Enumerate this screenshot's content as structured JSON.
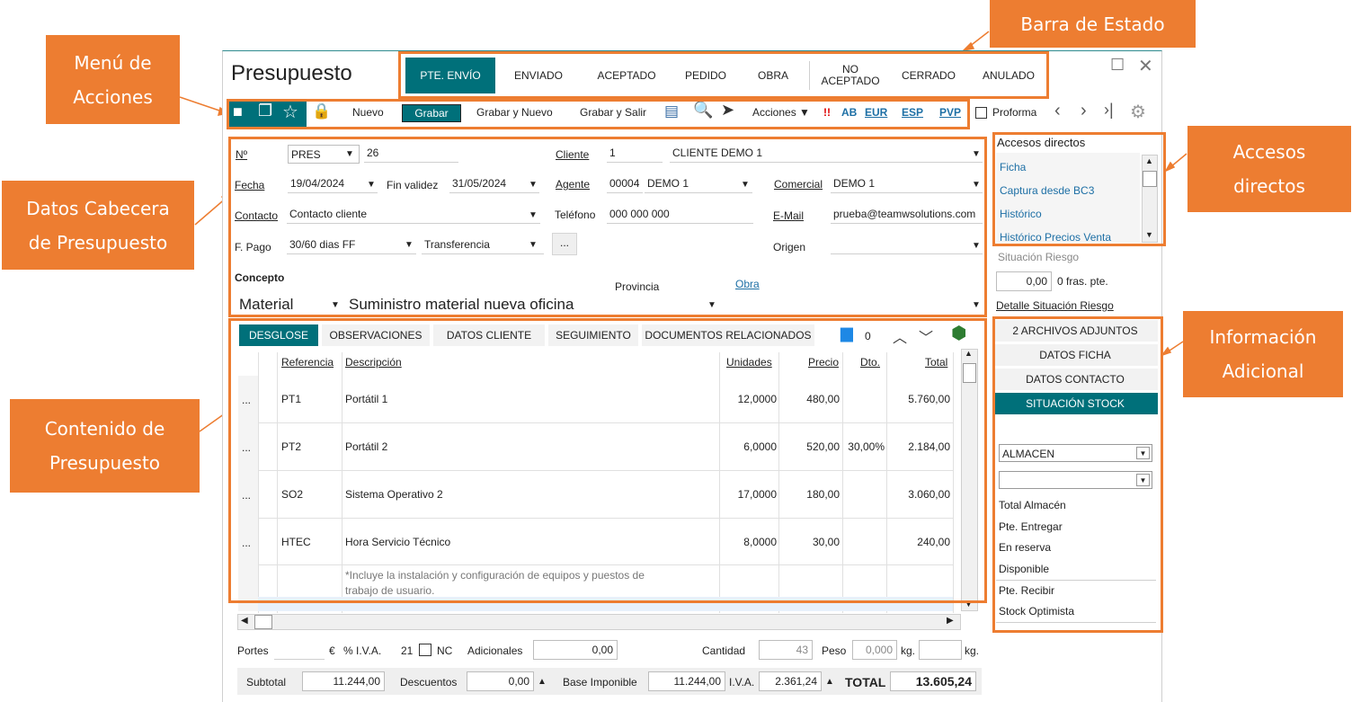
{
  "callouts": {
    "status_bar": "Barra de Estado",
    "actions_menu": "Menú de\nAcciones",
    "header_data": "Datos Cabecera\nde Presupuesto",
    "content": "Contenido de\nPresupuesto",
    "shortcuts": "Accesos\ndirectos",
    "additional": "Información\nAdicional"
  },
  "window": {
    "title": "Presupuesto"
  },
  "status_bar": [
    "PTE. ENVÍO",
    "ENVIADO",
    "ACEPTADO",
    "PEDIDO",
    "OBRA",
    "NO\nACEPTADO",
    "CERRADO",
    "ANULADO"
  ],
  "toolbar": {
    "nuevo": "Nuevo",
    "grabar": "Grabar",
    "grabar_nuevo": "Grabar y Nuevo",
    "grabar_salir": "Grabar y Salir",
    "acciones": "Acciones",
    "alert": "!!",
    "ab": "AB",
    "eur": "EUR",
    "esp": "ESP",
    "pvp": "PVP",
    "proforma": "Proforma"
  },
  "header": {
    "num_label": "Nº",
    "num_series": "PRES",
    "num_value": "26",
    "cliente_label": "Cliente",
    "cliente_code": "1",
    "cliente_name": "CLIENTE DEMO 1",
    "fecha_label": "Fecha",
    "fecha_value": "19/04/2024",
    "fin_validez_label": "Fin validez",
    "fin_validez_value": "31/05/2024",
    "agente_label": "Agente",
    "agente_code": "00004",
    "agente_name": "DEMO 1",
    "comercial_label": "Comercial",
    "comercial_value": "DEMO 1",
    "contacto_label": "Contacto",
    "contacto_value": "Contacto cliente",
    "telefono_label": "Teléfono",
    "telefono_value": "000 000 000",
    "email_label": "E-Mail",
    "email_value": "prueba@teamwsolutions.com",
    "fpago_label": "F. Pago",
    "fpago_value": "30/60 dias FF",
    "transferencia_value": "Transferencia",
    "ellipsis": "...",
    "origen_label": "Origen",
    "concepto_label": "Concepto",
    "concepto_type": "Material",
    "concepto_value": "Suministro material nueva oficina",
    "provincia_label": "Provincia",
    "obra_label": "Obra"
  },
  "tabs": [
    "DESGLOSE",
    "OBSERVACIONES",
    "DATOS CLIENTE",
    "SEGUIMIENTO",
    "DOCUMENTOS RELACIONADOS"
  ],
  "comments_count": "0",
  "table": {
    "headers": {
      "referencia": "Referencia",
      "descripcion": "Descripción",
      "unidades": "Unidades",
      "precio": "Precio",
      "dto": "Dto.",
      "total": "Total"
    },
    "rows": [
      {
        "more": "...",
        "ref": "PT1",
        "desc": "Portátil 1",
        "unid": "12,0000",
        "precio": "480,00",
        "dto": "",
        "total": "5.760,00"
      },
      {
        "more": "...",
        "ref": "PT2",
        "desc": "Portátil 2",
        "unid": "6,0000",
        "precio": "520,00",
        "dto": "30,00%",
        "total": "2.184,00"
      },
      {
        "more": "...",
        "ref": "SO2",
        "desc": "Sistema Operativo 2",
        "unid": "17,0000",
        "precio": "180,00",
        "dto": "",
        "total": "3.060,00"
      },
      {
        "more": "...",
        "ref": "HTEC",
        "desc": "Hora Servicio Técnico",
        "unid": "8,0000",
        "precio": "30,00",
        "dto": "",
        "total": "240,00"
      }
    ],
    "note": "*Incluye la instalación y configuración de equipos y puestos de\ntrabajo de usuario."
  },
  "sidebar": {
    "shortcuts_title": "Accesos directos",
    "shortcuts": [
      "Ficha",
      "Captura desde BC3",
      "Histórico",
      "Histórico Precios Venta"
    ],
    "risk_label": "Situación Riesgo",
    "risk_value": "0,00",
    "risk_fras": "0 fras. pte.",
    "risk_detail": "Detalle Situación Riesgo",
    "buttons": [
      "2 ARCHIVOS ADJUNTOS",
      "DATOS FICHA",
      "DATOS CONTACTO",
      "SITUACIÓN STOCK"
    ],
    "almacen": "ALMACEN",
    "stock_labels": [
      "Total Almacén",
      "Pte. Entregar",
      "En reserva",
      "Disponible",
      "Pte. Recibir",
      "Stock Optimista"
    ]
  },
  "footer": {
    "portes_label": "Portes",
    "euro": "€",
    "iva_pct_label": "% I.V.A.",
    "iva_pct_value": "21",
    "nc_label": "NC",
    "adicionales_label": "Adicionales",
    "adicionales_value": "0,00",
    "cantidad_label": "Cantidad",
    "cantidad_value": "43",
    "peso_label": "Peso",
    "peso_value": "0,000",
    "kg1": "kg.",
    "kg2": "kg.",
    "subtotal_label": "Subtotal",
    "subtotal_value": "11.244,00",
    "descuentos_label": "Descuentos",
    "descuentos_value": "0,00",
    "base_label": "Base Imponible",
    "base_value": "11.244,00",
    "iva_label": "I.V.A.",
    "iva_value": "2.361,24",
    "total_label": "TOTAL",
    "total_value": "13.605,24"
  },
  "colors": {
    "accent": "#ED7D31",
    "teal": "#00707A",
    "link": "#1d6fa5"
  }
}
